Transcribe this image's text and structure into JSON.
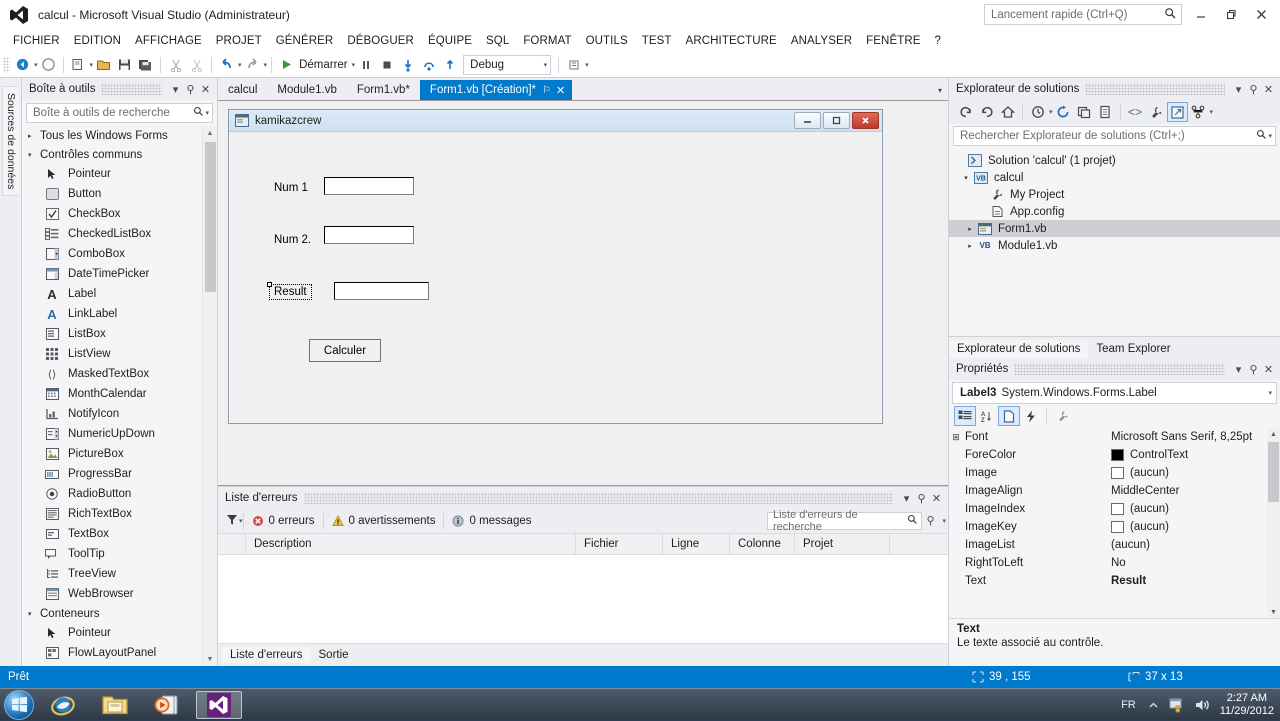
{
  "titlebar": {
    "title": "calcul - Microsoft Visual Studio (Administrateur)",
    "quick_launch_placeholder": "Lancement rapide (Ctrl+Q)",
    "minimize": "–",
    "restore": "❐",
    "close": "✕"
  },
  "menu": [
    "FICHIER",
    "EDITION",
    "AFFICHAGE",
    "PROJET",
    "GÉNÉRER",
    "DÉBOGUER",
    "ÉQUIPE",
    "SQL",
    "FORMAT",
    "OUTILS",
    "TEST",
    "ARCHITECTURE",
    "ANALYSER",
    "FENÊTRE",
    "?"
  ],
  "toolbar": {
    "start_label": "Démarrer",
    "config": "Debug",
    "caret": "▾"
  },
  "left_strip": {
    "data_sources_tab": "Sources de données"
  },
  "toolbox": {
    "title": "Boîte à outils",
    "search_placeholder": "Boîte à outils de recherche",
    "groups": [
      {
        "name": "Tous les Windows Forms",
        "expanded": false,
        "triangle": "▸",
        "items": []
      },
      {
        "name": "Contrôles communs",
        "expanded": true,
        "triangle": "▾",
        "items": [
          {
            "label": "Pointeur",
            "icon": "pointer-icon"
          },
          {
            "label": "Button",
            "icon": "button-icon"
          },
          {
            "label": "CheckBox",
            "icon": "checkbox-icon"
          },
          {
            "label": "CheckedListBox",
            "icon": "checkedlistbox-icon"
          },
          {
            "label": "ComboBox",
            "icon": "combobox-icon"
          },
          {
            "label": "DateTimePicker",
            "icon": "datetimepicker-icon"
          },
          {
            "label": "Label",
            "icon": "label-icon"
          },
          {
            "label": "LinkLabel",
            "icon": "linklabel-icon"
          },
          {
            "label": "ListBox",
            "icon": "listbox-icon"
          },
          {
            "label": "ListView",
            "icon": "listview-icon"
          },
          {
            "label": "MaskedTextBox",
            "icon": "maskedtextbox-icon"
          },
          {
            "label": "MonthCalendar",
            "icon": "monthcalendar-icon"
          },
          {
            "label": "NotifyIcon",
            "icon": "notifyicon-icon"
          },
          {
            "label": "NumericUpDown",
            "icon": "numericupdown-icon"
          },
          {
            "label": "PictureBox",
            "icon": "picturebox-icon"
          },
          {
            "label": "ProgressBar",
            "icon": "progressbar-icon"
          },
          {
            "label": "RadioButton",
            "icon": "radiobutton-icon"
          },
          {
            "label": "RichTextBox",
            "icon": "richtextbox-icon"
          },
          {
            "label": "TextBox",
            "icon": "textbox-icon"
          },
          {
            "label": "ToolTip",
            "icon": "tooltip-icon"
          },
          {
            "label": "TreeView",
            "icon": "treeview-icon"
          },
          {
            "label": "WebBrowser",
            "icon": "webbrowser-icon"
          }
        ]
      },
      {
        "name": "Conteneurs",
        "expanded": true,
        "triangle": "▾",
        "items": [
          {
            "label": "Pointeur",
            "icon": "pointer-icon"
          },
          {
            "label": "FlowLayoutPanel",
            "icon": "flowlayoutpanel-icon"
          }
        ]
      }
    ]
  },
  "document_tabs": [
    {
      "label": "calcul",
      "active": false
    },
    {
      "label": "Module1.vb",
      "active": false
    },
    {
      "label": "Form1.vb*",
      "active": false
    },
    {
      "label": "Form1.vb [Création]*",
      "active": true,
      "pin": "⚐",
      "close": "✕"
    }
  ],
  "designer": {
    "form_title": "kamikazcrew",
    "controls": [
      {
        "name": "label-num1",
        "type": "label",
        "text": "Num 1"
      },
      {
        "name": "textbox-num1",
        "type": "textbox",
        "text": ""
      },
      {
        "name": "label-num2",
        "type": "label",
        "text": "Num 2."
      },
      {
        "name": "textbox-num2",
        "type": "textbox",
        "text": ""
      },
      {
        "name": "label-result",
        "type": "label",
        "text": "Result",
        "selected": true
      },
      {
        "name": "textbox-result",
        "type": "textbox",
        "text": ""
      },
      {
        "name": "button-calculer",
        "type": "button",
        "text": "Calculer"
      }
    ]
  },
  "error_list": {
    "title": "Liste d'erreurs",
    "errors": "0 erreurs",
    "warnings": "0 avertissements",
    "messages": "0 messages",
    "search_placeholder": "Liste d'erreurs de recherche",
    "columns": [
      "Description",
      "Fichier",
      "Ligne",
      "Colonne",
      "Projet"
    ],
    "rows": [],
    "tabs": [
      {
        "label": "Liste d'erreurs",
        "active": true
      },
      {
        "label": "Sortie",
        "active": false
      }
    ]
  },
  "solution_explorer": {
    "title": "Explorateur de solutions",
    "search_placeholder": "Rechercher Explorateur de solutions (Ctrl+;)",
    "tree": [
      {
        "label": "Solution 'calcul' (1 projet)",
        "indent": 0,
        "triangle": "",
        "icon": "solution-icon",
        "selected": false
      },
      {
        "label": "calcul",
        "indent": 1,
        "triangle": "▾",
        "icon": "vb-project-icon",
        "selected": false
      },
      {
        "label": "My Project",
        "indent": 2,
        "triangle": "",
        "icon": "wrench-icon",
        "selected": false
      },
      {
        "label": "App.config",
        "indent": 2,
        "triangle": "",
        "icon": "config-icon",
        "selected": false
      },
      {
        "label": "Form1.vb",
        "indent": 2,
        "triangle": "▸",
        "icon": "form-icon",
        "selected": true
      },
      {
        "label": "Module1.vb",
        "indent": 2,
        "triangle": "▸",
        "icon": "vb-file-icon",
        "selected": false
      }
    ],
    "bottom_tabs": [
      {
        "label": "Explorateur de solutions",
        "active": true
      },
      {
        "label": "Team Explorer",
        "active": false
      }
    ]
  },
  "properties": {
    "title": "Propriétés",
    "object_name": "Label3",
    "object_type": "System.Windows.Forms.Label",
    "rows": [
      {
        "key": "Font",
        "value": "Microsoft Sans Serif, 8,25pt",
        "expandable": true,
        "swatch": null,
        "bold": false
      },
      {
        "key": "ForeColor",
        "value": "ControlText",
        "expandable": false,
        "swatch": "#000000",
        "bold": false
      },
      {
        "key": "Image",
        "value": "(aucun)",
        "expandable": false,
        "swatch": "#ffffff",
        "bold": false
      },
      {
        "key": "ImageAlign",
        "value": "MiddleCenter",
        "expandable": false,
        "swatch": null,
        "bold": false
      },
      {
        "key": "ImageIndex",
        "value": "(aucun)",
        "expandable": false,
        "swatch": "#ffffff",
        "bold": false
      },
      {
        "key": "ImageKey",
        "value": "(aucun)",
        "expandable": false,
        "swatch": "#ffffff",
        "bold": false
      },
      {
        "key": "ImageList",
        "value": "(aucun)",
        "expandable": false,
        "swatch": null,
        "bold": false
      },
      {
        "key": "RightToLeft",
        "value": "No",
        "expandable": false,
        "swatch": null,
        "bold": false
      },
      {
        "key": "Text",
        "value": "Result",
        "expandable": false,
        "swatch": null,
        "bold": true
      }
    ],
    "description_title": "Text",
    "description_body": "Le texte associé au contrôle."
  },
  "statusbar": {
    "ready": "Prêt",
    "position": "39 , 155",
    "size": "37 x 13"
  },
  "taskbar": {
    "apps": [
      {
        "name": "internet-explorer",
        "active": false
      },
      {
        "name": "file-explorer",
        "active": false
      },
      {
        "name": "media-player",
        "active": false
      },
      {
        "name": "visual-studio",
        "active": true
      }
    ],
    "language": "FR",
    "time": "2:27 AM",
    "date": "11/29/2012"
  },
  "colors": {
    "accent": "#007acc",
    "titlebar_bg": "#ffffff",
    "chrome_bg": "#eeeef2"
  }
}
